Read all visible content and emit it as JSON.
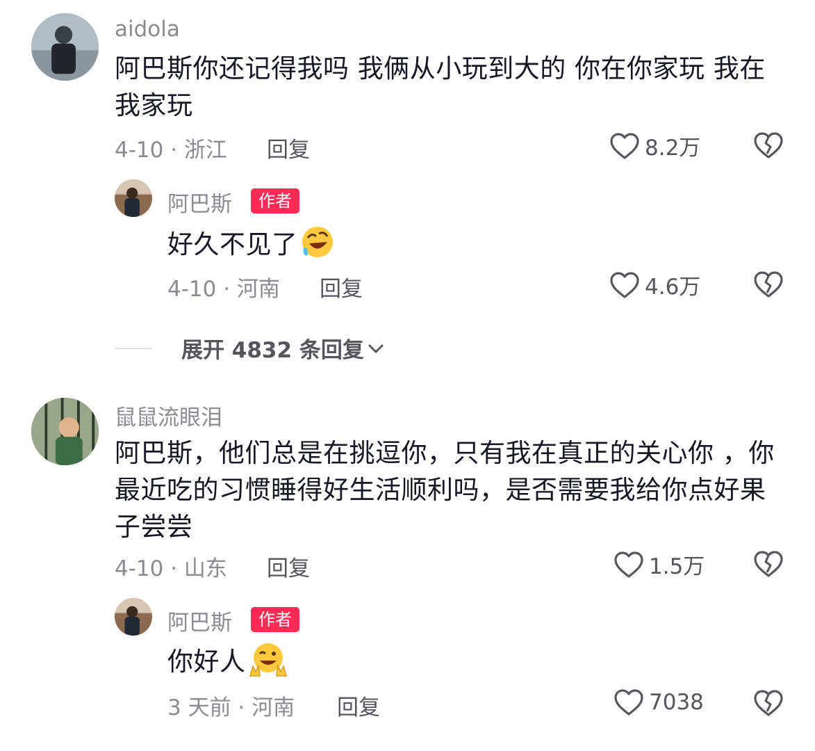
{
  "comments": [
    {
      "username": "aidola",
      "text": "阿巴斯你还记得我吗 我俩从小玩到大的 你在你家玩 我在我家玩",
      "date_location": "4-10 · 浙江",
      "reply_label": "回复",
      "likes": "8.2万",
      "replies": [
        {
          "username": "阿巴斯",
          "badge": "作者",
          "text": "好久不见了",
          "emoji": "rofl-emoji",
          "date_location": "4-10 · 河南",
          "reply_label": "回复",
          "likes": "4.6万"
        }
      ],
      "expand_label": "展开 4832 条回复"
    },
    {
      "username": "鼠鼠流眼泪",
      "text": "阿巴斯，他们总是在挑逗你，只有我在真正的关心你 ，你最近吃的习惯睡得好生活顺利吗，是否需要我给你点好果子尝尝",
      "date_location": "4-10 · 山东",
      "reply_label": "回复",
      "likes": "1.5万",
      "replies": [
        {
          "username": "阿巴斯",
          "badge": "作者",
          "text": "你好人",
          "emoji": "wink-peace-emoji",
          "date_location": "3 天前 · 河南",
          "reply_label": "回复",
          "likes": "7038"
        }
      ]
    }
  ],
  "colors": {
    "badge": "#fe2c55",
    "text": "#161823",
    "secondary": "#8a8b91",
    "icon": "#55565c"
  },
  "icons": [
    "heart-outline-icon",
    "broken-heart-icon",
    "chevron-down-icon"
  ]
}
